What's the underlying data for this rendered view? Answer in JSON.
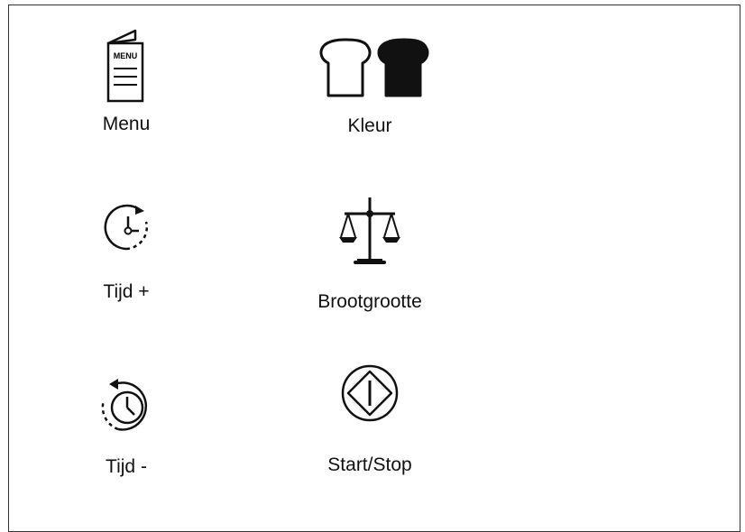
{
  "buttons": [
    {
      "id": "menu",
      "icon": "menu-card-icon",
      "label": "Menu",
      "badge_text": "MENU"
    },
    {
      "id": "color",
      "icon": "bread-color-icon",
      "label": "Kleur"
    },
    {
      "id": "time-plus",
      "icon": "clock-forward-icon",
      "label": "Tijd +"
    },
    {
      "id": "loaf-size",
      "icon": "scale-icon",
      "label": "Brootgrootte"
    },
    {
      "id": "time-minus",
      "icon": "clock-backward-icon",
      "label": "Tijd -"
    },
    {
      "id": "start-stop",
      "icon": "start-stop-icon",
      "label": "Start/Stop"
    }
  ]
}
